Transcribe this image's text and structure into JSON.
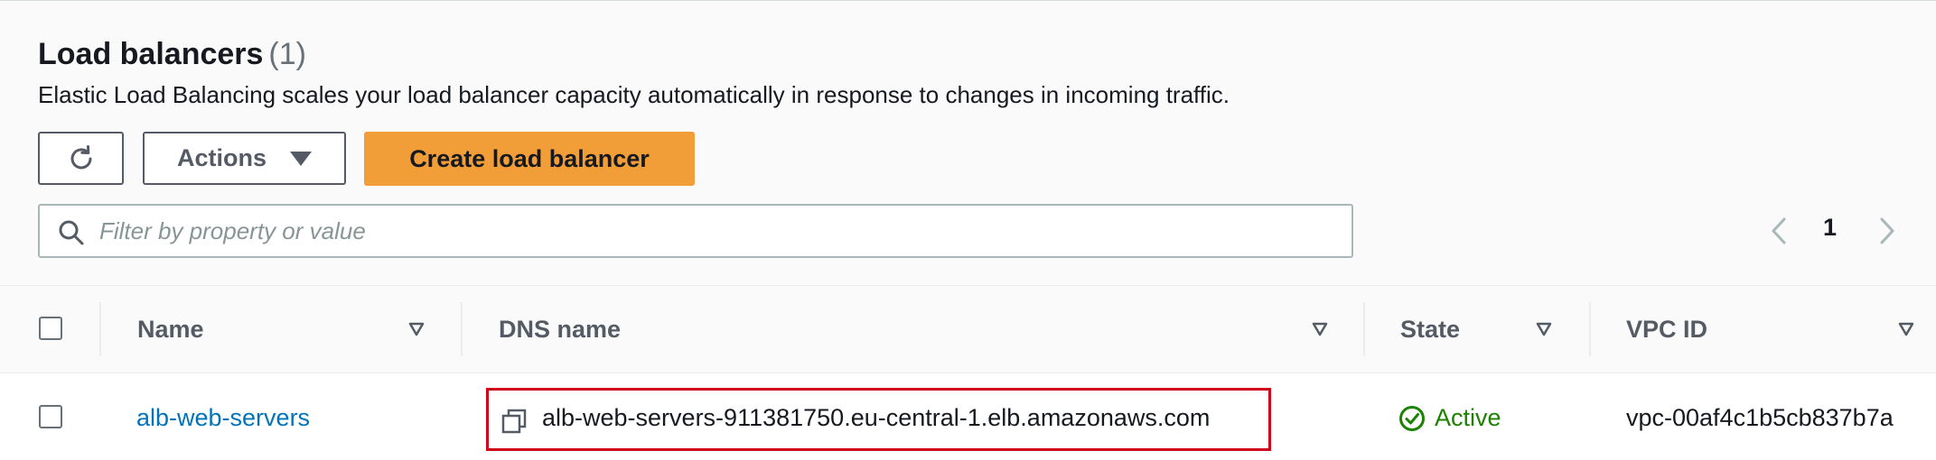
{
  "header": {
    "title": "Load balancers",
    "count": "(1)",
    "description": "Elastic Load Balancing scales your load balancer capacity automatically in response to changes in incoming traffic."
  },
  "toolbar": {
    "refresh_icon": "refresh-icon",
    "actions_label": "Actions",
    "create_label": "Create load balancer"
  },
  "search": {
    "placeholder": "Filter by property or value",
    "value": ""
  },
  "pagination": {
    "current_page": "1"
  },
  "table": {
    "columns": [
      "Name",
      "DNS name",
      "State",
      "VPC ID"
    ],
    "rows": [
      {
        "name": "alb-web-servers",
        "dns_name": "alb-web-servers-911381750.eu-central-1.elb.amazonaws.com",
        "state": "Active",
        "vpc_id": "vpc-00af4c1b5cb837b7a"
      }
    ]
  },
  "colors": {
    "primary_button": "#f29e38",
    "link": "#0073bb",
    "status_active": "#1d8102",
    "highlight_box": "#d0021b"
  }
}
